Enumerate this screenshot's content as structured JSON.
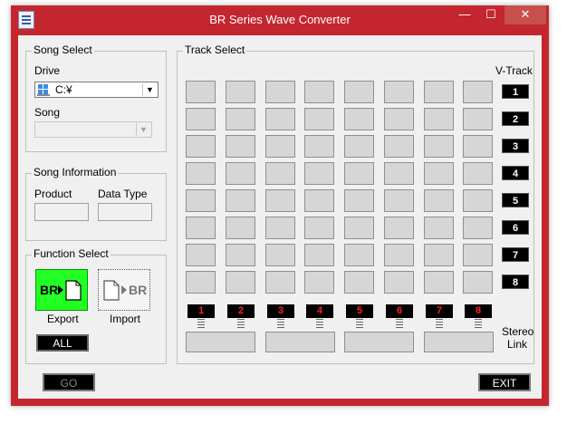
{
  "window": {
    "title": "BR Series Wave Converter",
    "min_glyph": "—",
    "max_glyph": "☐",
    "close_glyph": "✕"
  },
  "song_select": {
    "title": "Song Select",
    "drive_label": "Drive",
    "drive_value": "C:¥",
    "song_label": "Song",
    "song_value": ""
  },
  "song_info": {
    "title": "Song Information",
    "product_label": "Product",
    "data_type_label": "Data Type",
    "product_value": "",
    "data_type_value": ""
  },
  "function_select": {
    "title": "Function Select",
    "export_label": "Export",
    "import_label": "Import",
    "export_icon_text": "BR",
    "import_icon_text": "BR",
    "all_label": "ALL"
  },
  "track_select": {
    "title": "Track Select",
    "vtrack_label": "V-Track",
    "vtracks": [
      "1",
      "2",
      "3",
      "4",
      "5",
      "6",
      "7",
      "8"
    ],
    "tracks": [
      "1",
      "2",
      "3",
      "4",
      "5",
      "6",
      "7",
      "8"
    ],
    "stereo_link_line1": "Stereo",
    "stereo_link_line2": "Link"
  },
  "buttons": {
    "go_label": "GO",
    "exit_label": "EXIT"
  },
  "colors": {
    "titlebar": "#c3262f",
    "export_bg": "#22ff22",
    "track_number": "#ff2020"
  },
  "icons": [
    "app-icon",
    "drive-icon",
    "chevron-down-icon",
    "export-icon",
    "import-icon"
  ]
}
